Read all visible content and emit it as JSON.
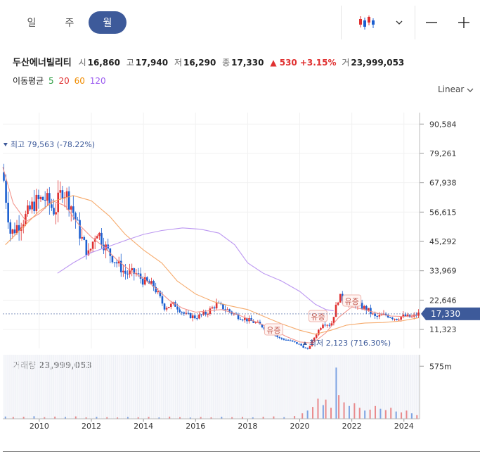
{
  "tabs": [
    {
      "label": "일"
    },
    {
      "label": "주"
    },
    {
      "label": "월"
    }
  ],
  "active_tab": 2,
  "quote": {
    "name": "두산에너빌리티",
    "open_label": "시",
    "open": "16,860",
    "high_label": "고",
    "high": "17,940",
    "low_label": "저",
    "low": "16,290",
    "close_label": "종",
    "close": "17,330",
    "change": "530",
    "change_pct": "+3.15%",
    "volume_label": "거",
    "volume": "23,999,053"
  },
  "ma": {
    "label": "이동평균",
    "periods": [
      "5",
      "20",
      "60",
      "120"
    ],
    "colors": [
      "#2f9e44",
      "#e03131",
      "#f08c00",
      "#9c5cf0"
    ]
  },
  "scale_mode": "Linear",
  "volume_title": "거래량",
  "volume_value": "23,999,053",
  "colors": {
    "up": "#e03131",
    "down": "#1c5fd0",
    "accent": "#3d5a9a"
  },
  "chart_data": {
    "type": "candlestick",
    "y_ticks": [
      "90,584",
      "79,261",
      "67,938",
      "56,615",
      "45,292",
      "33,969",
      "22,646",
      "11,323"
    ],
    "y_tick_values": [
      90584,
      79261,
      67938,
      56615,
      45292,
      33969,
      22646,
      11323
    ],
    "ylim": [
      4000,
      95000
    ],
    "x_ticks": [
      "2010",
      "2012",
      "2014",
      "2016",
      "2018",
      "2020",
      "2022",
      "2024"
    ],
    "x_tick_years": [
      2010,
      2012,
      2014,
      2016,
      2018,
      2020,
      2022,
      2024
    ],
    "xlim": [
      2008.6,
      2024.6
    ],
    "current_price_label": "17,330",
    "current_price": 17330,
    "high_annotation": {
      "text": "최고 79,563 (-78.22%)",
      "x": 2008.65,
      "price": 79563
    },
    "low_annotation": {
      "text": "최저 2,123 (716.30%)",
      "x": 2020.2,
      "price": 2123
    },
    "rights_issue_label": "유증",
    "rights_issues": [
      {
        "x": 2019.0
      },
      {
        "x": 2020.7
      },
      {
        "x": 2022.0
      }
    ],
    "close_series": [
      {
        "x": 2008.6,
        "y": 72000
      },
      {
        "x": 2008.9,
        "y": 48000
      },
      {
        "x": 2009.2,
        "y": 52000
      },
      {
        "x": 2009.5,
        "y": 55000
      },
      {
        "x": 2009.8,
        "y": 60000
      },
      {
        "x": 2010.2,
        "y": 62000
      },
      {
        "x": 2010.6,
        "y": 57000
      },
      {
        "x": 2010.9,
        "y": 66000
      },
      {
        "x": 2011.2,
        "y": 60000
      },
      {
        "x": 2011.6,
        "y": 47000
      },
      {
        "x": 2011.9,
        "y": 40000
      },
      {
        "x": 2012.2,
        "y": 50000
      },
      {
        "x": 2012.6,
        "y": 42000
      },
      {
        "x": 2012.9,
        "y": 38000
      },
      {
        "x": 2013.3,
        "y": 33000
      },
      {
        "x": 2013.7,
        "y": 33000
      },
      {
        "x": 2014.0,
        "y": 30000
      },
      {
        "x": 2014.4,
        "y": 28000
      },
      {
        "x": 2014.8,
        "y": 20000
      },
      {
        "x": 2015.2,
        "y": 21000
      },
      {
        "x": 2015.6,
        "y": 17000
      },
      {
        "x": 2016.0,
        "y": 16000
      },
      {
        "x": 2016.4,
        "y": 17500
      },
      {
        "x": 2016.8,
        "y": 21000
      },
      {
        "x": 2017.2,
        "y": 19000
      },
      {
        "x": 2017.6,
        "y": 16500
      },
      {
        "x": 2018.0,
        "y": 15000
      },
      {
        "x": 2018.4,
        "y": 13500
      },
      {
        "x": 2018.8,
        "y": 11000
      },
      {
        "x": 2019.2,
        "y": 8000
      },
      {
        "x": 2019.6,
        "y": 7000
      },
      {
        "x": 2020.0,
        "y": 5500
      },
      {
        "x": 2020.3,
        "y": 3500
      },
      {
        "x": 2020.6,
        "y": 9000
      },
      {
        "x": 2020.9,
        "y": 14000
      },
      {
        "x": 2021.2,
        "y": 13000
      },
      {
        "x": 2021.5,
        "y": 24000
      },
      {
        "x": 2021.8,
        "y": 22000
      },
      {
        "x": 2022.2,
        "y": 21000
      },
      {
        "x": 2022.6,
        "y": 19000
      },
      {
        "x": 2022.9,
        "y": 16000
      },
      {
        "x": 2023.3,
        "y": 17000
      },
      {
        "x": 2023.7,
        "y": 15500
      },
      {
        "x": 2024.0,
        "y": 16500
      },
      {
        "x": 2024.3,
        "y": 16000
      },
      {
        "x": 2024.55,
        "y": 17330
      }
    ],
    "ma20_series": [
      {
        "x": 2008.6,
        "y": 74000
      },
      {
        "x": 2009.0,
        "y": 60000
      },
      {
        "x": 2009.5,
        "y": 53000
      },
      {
        "x": 2010.0,
        "y": 56000
      },
      {
        "x": 2010.5,
        "y": 61000
      },
      {
        "x": 2011.0,
        "y": 59000
      },
      {
        "x": 2011.5,
        "y": 52000
      },
      {
        "x": 2012.0,
        "y": 47000
      },
      {
        "x": 2012.5,
        "y": 43000
      },
      {
        "x": 2013.0,
        "y": 38000
      },
      {
        "x": 2013.5,
        "y": 34000
      },
      {
        "x": 2014.0,
        "y": 31000
      },
      {
        "x": 2014.5,
        "y": 27000
      },
      {
        "x": 2015.0,
        "y": 22500
      },
      {
        "x": 2015.5,
        "y": 19500
      },
      {
        "x": 2016.0,
        "y": 18000
      },
      {
        "x": 2016.5,
        "y": 18500
      },
      {
        "x": 2017.0,
        "y": 19000
      },
      {
        "x": 2017.5,
        "y": 17500
      },
      {
        "x": 2018.0,
        "y": 15500
      },
      {
        "x": 2018.5,
        "y": 13500
      },
      {
        "x": 2019.0,
        "y": 11000
      },
      {
        "x": 2019.5,
        "y": 8500
      },
      {
        "x": 2020.0,
        "y": 6500
      },
      {
        "x": 2020.5,
        "y": 6000
      },
      {
        "x": 2021.0,
        "y": 10000
      },
      {
        "x": 2021.5,
        "y": 16000
      },
      {
        "x": 2022.0,
        "y": 20000
      },
      {
        "x": 2022.5,
        "y": 19000
      },
      {
        "x": 2023.0,
        "y": 17500
      },
      {
        "x": 2023.5,
        "y": 16500
      },
      {
        "x": 2024.0,
        "y": 16300
      },
      {
        "x": 2024.55,
        "y": 16800
      }
    ],
    "ma60_series": [
      {
        "x": 2008.7,
        "y": 44000
      },
      {
        "x": 2009.3,
        "y": 50000
      },
      {
        "x": 2010.0,
        "y": 57000
      },
      {
        "x": 2010.6,
        "y": 61000
      },
      {
        "x": 2011.3,
        "y": 63000
      },
      {
        "x": 2012.0,
        "y": 61000
      },
      {
        "x": 2012.7,
        "y": 55000
      },
      {
        "x": 2013.3,
        "y": 48000
      },
      {
        "x": 2014.0,
        "y": 42000
      },
      {
        "x": 2014.7,
        "y": 37000
      },
      {
        "x": 2015.3,
        "y": 30000
      },
      {
        "x": 2016.0,
        "y": 25000
      },
      {
        "x": 2016.7,
        "y": 22000
      },
      {
        "x": 2017.3,
        "y": 20500
      },
      {
        "x": 2018.0,
        "y": 19000
      },
      {
        "x": 2018.7,
        "y": 16000
      },
      {
        "x": 2019.3,
        "y": 13500
      },
      {
        "x": 2020.0,
        "y": 11000
      },
      {
        "x": 2020.6,
        "y": 9500
      },
      {
        "x": 2021.2,
        "y": 11000
      },
      {
        "x": 2021.8,
        "y": 13000
      },
      {
        "x": 2022.5,
        "y": 13800
      },
      {
        "x": 2023.2,
        "y": 14000
      },
      {
        "x": 2023.9,
        "y": 14600
      },
      {
        "x": 2024.55,
        "y": 15800
      }
    ],
    "ma120_series": [
      {
        "x": 2010.7,
        "y": 33000
      },
      {
        "x": 2011.3,
        "y": 37000
      },
      {
        "x": 2012.0,
        "y": 41000
      },
      {
        "x": 2012.7,
        "y": 43500
      },
      {
        "x": 2013.4,
        "y": 46000
      },
      {
        "x": 2014.0,
        "y": 48000
      },
      {
        "x": 2014.7,
        "y": 49500
      },
      {
        "x": 2015.5,
        "y": 50500
      },
      {
        "x": 2016.2,
        "y": 50000
      },
      {
        "x": 2016.9,
        "y": 48500
      },
      {
        "x": 2017.5,
        "y": 44000
      },
      {
        "x": 2018.0,
        "y": 37000
      },
      {
        "x": 2018.6,
        "y": 33000
      },
      {
        "x": 2019.3,
        "y": 30000
      },
      {
        "x": 2020.0,
        "y": 26000
      },
      {
        "x": 2020.6,
        "y": 21000
      },
      {
        "x": 2021.0,
        "y": 19000
      },
      {
        "x": 2021.3,
        "y": 18500
      }
    ],
    "volume_tick": "575m",
    "volume_tick_value": 575,
    "volume_max": 700,
    "volume_series": [
      {
        "x": 2008.7,
        "y": 25
      },
      {
        "x": 2009.0,
        "y": 20
      },
      {
        "x": 2009.4,
        "y": 22
      },
      {
        "x": 2009.8,
        "y": 28
      },
      {
        "x": 2010.2,
        "y": 18
      },
      {
        "x": 2010.6,
        "y": 24
      },
      {
        "x": 2011.0,
        "y": 20
      },
      {
        "x": 2011.4,
        "y": 26
      },
      {
        "x": 2011.8,
        "y": 16
      },
      {
        "x": 2012.2,
        "y": 22
      },
      {
        "x": 2012.6,
        "y": 18
      },
      {
        "x": 2013.0,
        "y": 15
      },
      {
        "x": 2013.4,
        "y": 20
      },
      {
        "x": 2013.8,
        "y": 17
      },
      {
        "x": 2014.2,
        "y": 21
      },
      {
        "x": 2014.6,
        "y": 15
      },
      {
        "x": 2015.0,
        "y": 24
      },
      {
        "x": 2015.4,
        "y": 18
      },
      {
        "x": 2015.8,
        "y": 14
      },
      {
        "x": 2016.2,
        "y": 20
      },
      {
        "x": 2016.6,
        "y": 16
      },
      {
        "x": 2017.0,
        "y": 22
      },
      {
        "x": 2017.4,
        "y": 18
      },
      {
        "x": 2017.8,
        "y": 20
      },
      {
        "x": 2018.2,
        "y": 16
      },
      {
        "x": 2018.6,
        "y": 22
      },
      {
        "x": 2019.0,
        "y": 26
      },
      {
        "x": 2019.4,
        "y": 18
      },
      {
        "x": 2019.8,
        "y": 30
      },
      {
        "x": 2020.1,
        "y": 60
      },
      {
        "x": 2020.3,
        "y": 90
      },
      {
        "x": 2020.5,
        "y": 130
      },
      {
        "x": 2020.7,
        "y": 220
      },
      {
        "x": 2020.9,
        "y": 150
      },
      {
        "x": 2021.0,
        "y": 210
      },
      {
        "x": 2021.2,
        "y": 120
      },
      {
        "x": 2021.4,
        "y": 560
      },
      {
        "x": 2021.5,
        "y": 260
      },
      {
        "x": 2021.7,
        "y": 180
      },
      {
        "x": 2021.9,
        "y": 140
      },
      {
        "x": 2022.1,
        "y": 170
      },
      {
        "x": 2022.3,
        "y": 120
      },
      {
        "x": 2022.5,
        "y": 90
      },
      {
        "x": 2022.7,
        "y": 100
      },
      {
        "x": 2022.9,
        "y": 140
      },
      {
        "x": 2023.1,
        "y": 110
      },
      {
        "x": 2023.3,
        "y": 95
      },
      {
        "x": 2023.5,
        "y": 120
      },
      {
        "x": 2023.7,
        "y": 80
      },
      {
        "x": 2023.9,
        "y": 70
      },
      {
        "x": 2024.1,
        "y": 90
      },
      {
        "x": 2024.3,
        "y": 60
      },
      {
        "x": 2024.5,
        "y": 40
      }
    ]
  }
}
